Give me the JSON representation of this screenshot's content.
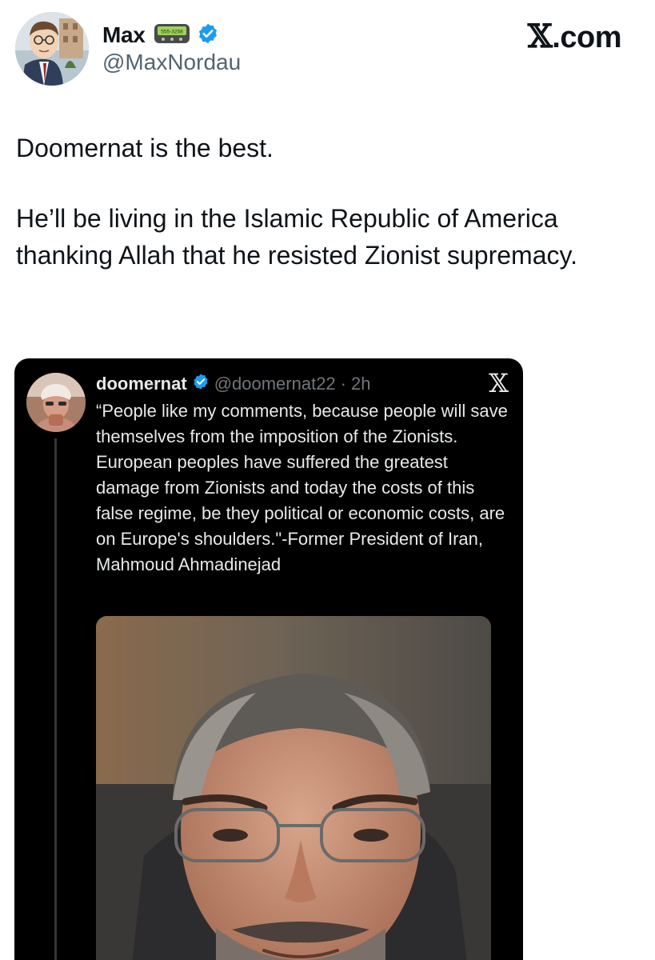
{
  "author": {
    "display_name": "Max",
    "handle": "@MaxNordau",
    "avatar_icon": "cartoon-avatar",
    "pager_text": "555-3258"
  },
  "brand": {
    "label": ".com",
    "x_glyph": "𝕏"
  },
  "tweet": {
    "paragraphs": [
      "Doomernat is the best.",
      "He’ll be living in the Islamic Republic of America thanking Allah that he resisted Zionist supremacy."
    ]
  },
  "quoted": {
    "display_name": "doomernat",
    "handle": "@doomernat22",
    "separator": "·",
    "time": "2h",
    "close_glyph": "𝕏",
    "text": "“People like my comments, because people will save themselves from the imposition of the Zionists. European peoples have suffered the greatest damage from Zionists and today the costs of this false regime, be they political or economic costs, are on Europe's shoulders.\"-Former President of Iran, Mahmoud Ahmadinejad",
    "media_icon": "portrait-photo"
  },
  "colors": {
    "verified": "#1d9bf0",
    "text_primary": "#0f1419",
    "text_secondary": "#536471",
    "card_bg": "#000000",
    "card_text": "#e7e9ea",
    "card_muted": "#71767b"
  }
}
